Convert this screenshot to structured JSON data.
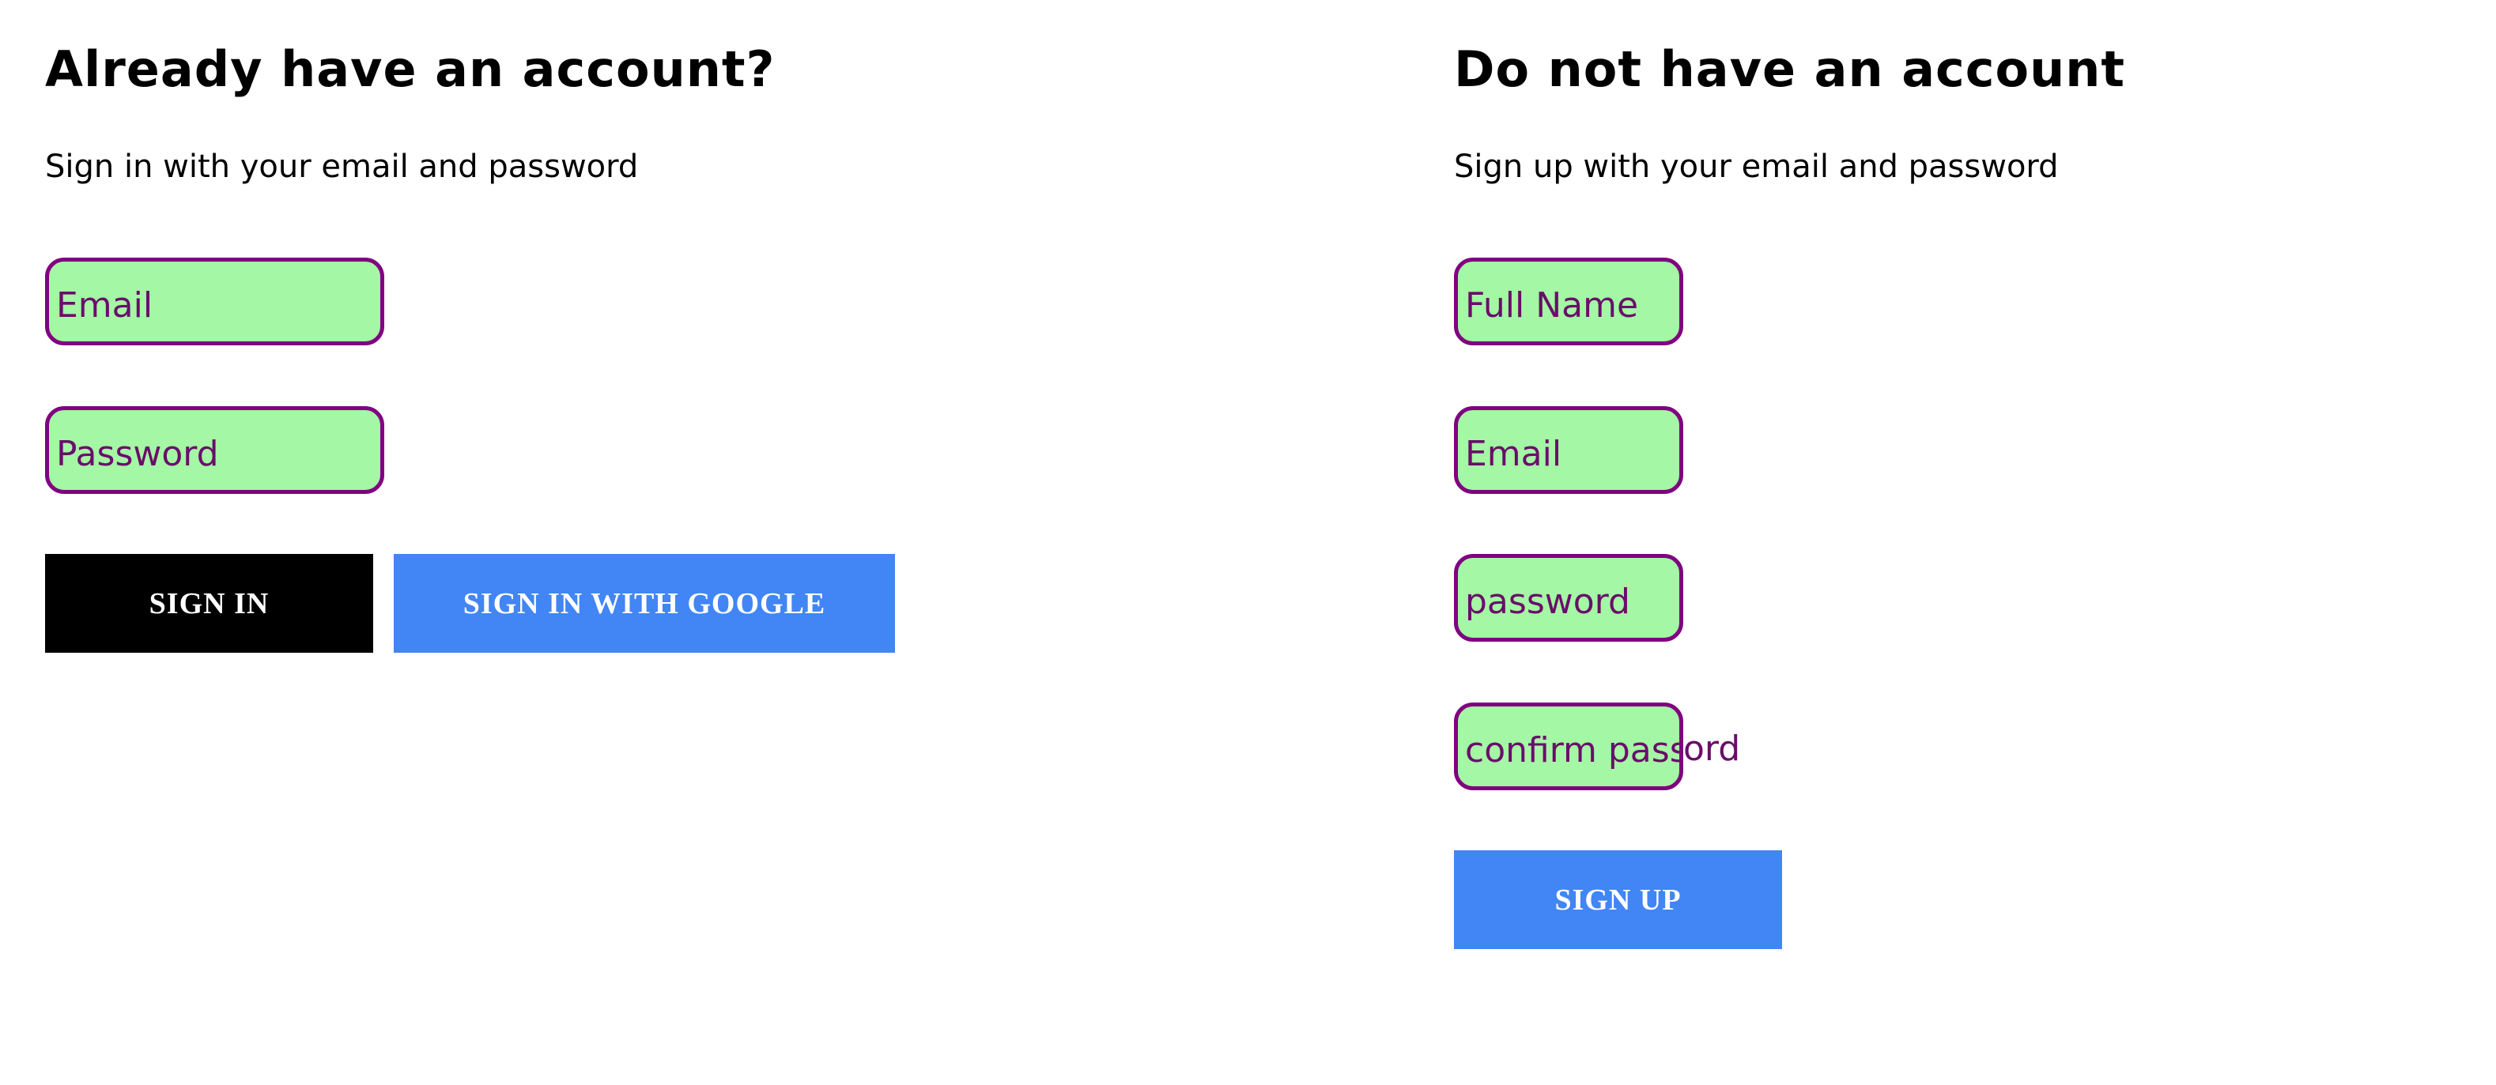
{
  "signin": {
    "heading": "Already have an account?",
    "subheading": "Sign in with your email and password",
    "email_placeholder": "Email",
    "password_placeholder": "Password",
    "signin_button": "SIGN IN",
    "google_button": "SIGN IN WITH GOOGLE"
  },
  "signup": {
    "heading": "Do not have an account",
    "subheading": "Sign up with your email and password",
    "fullname_placeholder": "Full Name",
    "email_placeholder": "Email",
    "password_placeholder": "password",
    "confirm_placeholder": "confirm password",
    "confirm_overflow_text": "ord",
    "signup_button": "SIGN UP"
  },
  "colors": {
    "field_background": "#a4f7a4",
    "field_border": "#800080",
    "placeholder_text": "#6a0d6a",
    "primary_dark": "#000000",
    "google_blue": "#4285f4",
    "button_text": "#ffffff"
  }
}
